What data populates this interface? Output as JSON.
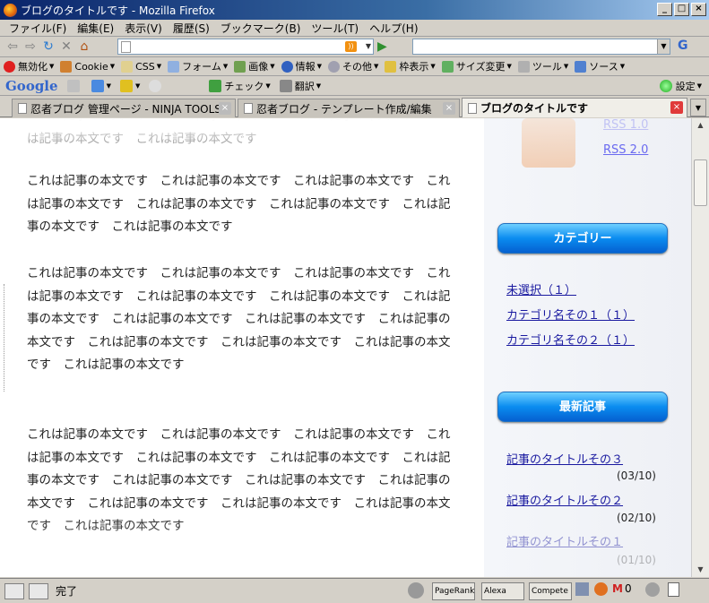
{
  "window": {
    "title": "ブログのタイトルです - Mozilla Firefox"
  },
  "menu": [
    "ファイル(F)",
    "編集(E)",
    "表示(V)",
    "履歴(S)",
    "ブックマーク(B)",
    "ツール(T)",
    "ヘルプ(H)"
  ],
  "devtoolbar": [
    "無効化",
    "Cookie",
    "CSS",
    "フォーム",
    "画像",
    "情報",
    "その他",
    "枠表示",
    "サイズ変更",
    "ツール",
    "ソース"
  ],
  "googlebar": {
    "logo": "Google",
    "check": "チェック",
    "translate": "翻訳",
    "settings": "設定"
  },
  "tabs": [
    {
      "label": "忍者ブログ 管理ページ - NINJA TOOLS",
      "active": false
    },
    {
      "label": "忍者ブログ - テンプレート作成/編集",
      "active": false
    },
    {
      "label": "ブログのタイトルです",
      "active": true
    }
  ],
  "main": {
    "paragraphs": [
      "これは記事の本文です　これは記事の本文です　これは記事の本文です　これは記事の本文です　これは記事の本文です",
      "これは記事の本文です　これは記事の本文です　これは記事の本文です　これは記事の本文です　これは記事の本文です　これは記事の本文です　これは記事の本文です　これは記事の本文です",
      "これは記事の本文です　これは記事の本文です　これは記事の本文です　これは記事の本文です　これは記事の本文です　これは記事の本文です　これは記事の本文です　これは記事の本文です　これは記事の本文です　これは記事の本文です　これは記事の本文です　これは記事の本文です　これは記事の本文です　これは記事の本文です",
      "これは記事の本文です　これは記事の本文です　これは記事の本文です　これは記事の本文です　これは記事の本文です　これは記事の本文です　これは記事の本文です　これは記事の本文です　これは記事の本文です　これは記事の本文です　これは記事の本文です　これは記事の本文です　これは記事の本文です　これは記事の本文です"
    ]
  },
  "sidebar": {
    "rss_top": "RSS 1.0",
    "rss": "RSS 2.0",
    "category_title": "カテゴリー",
    "categories": [
      "未選択（１）",
      "カテゴリ名その１（１）",
      "カテゴリ名その２（１）"
    ],
    "recent_title": "最新記事",
    "recent": [
      {
        "title": "記事のタイトルその３",
        "date": "(03/10)"
      },
      {
        "title": "記事のタイトルその２",
        "date": "(02/10)"
      },
      {
        "title": "記事のタイトルその１",
        "date": "(01/10)"
      }
    ]
  },
  "status": {
    "text": "完了",
    "pagerank": "PageRank",
    "alexa": "Alexa",
    "compete": "Compete",
    "count": "0"
  }
}
